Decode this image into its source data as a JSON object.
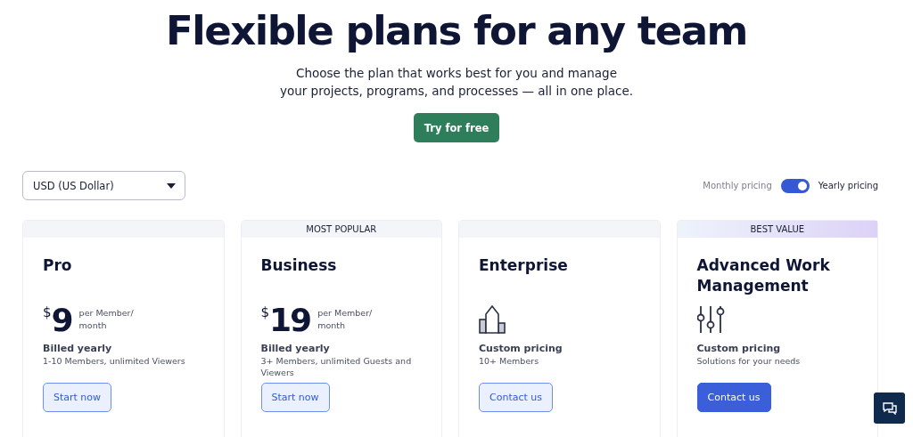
{
  "hero": {
    "title": "Flexible plans for any team",
    "subtitle_lines": [
      "Choose the plan that works best for you and manage",
      "your projects, programs, and processes — all in one place."
    ],
    "cta": "Try for free"
  },
  "currency": {
    "value": "USD (US Dollar)"
  },
  "pricing_switch": {
    "on": true
  },
  "pricing_toggle": [
    {
      "label": "Monthly pricing",
      "selected": false
    },
    {
      "label": "Yearly pricing",
      "selected": true
    }
  ],
  "plans": [
    {
      "name": "Pro",
      "kind": "price",
      "currency": "$",
      "amount": "9",
      "unit": "per Member/ month",
      "billing": "Billed yearly",
      "details": "1-10 Members, unlimited Viewers",
      "button": "Start now",
      "primary": false
    },
    {
      "badge": "MOST POPULAR",
      "highlighted": false,
      "name": "Business",
      "kind": "price",
      "currency": "$",
      "amount": "19",
      "unit": "per Member/ month",
      "billing": "Billed yearly",
      "details": "3+ Members, unlimited Guests and Viewers",
      "button": "Start now",
      "primary": false
    },
    {
      "name": "Enterprise",
      "kind": "building",
      "billing": "Custom pricing",
      "details": "10+ Members",
      "button": "Contact us",
      "primary": false
    },
    {
      "badge": "BEST VALUE",
      "highlighted": true,
      "name": "Advanced Work Management",
      "kind": "sliders",
      "billing": "Custom pricing",
      "details": "Solutions for your needs",
      "button": "Contact us",
      "primary": true
    }
  ]
}
